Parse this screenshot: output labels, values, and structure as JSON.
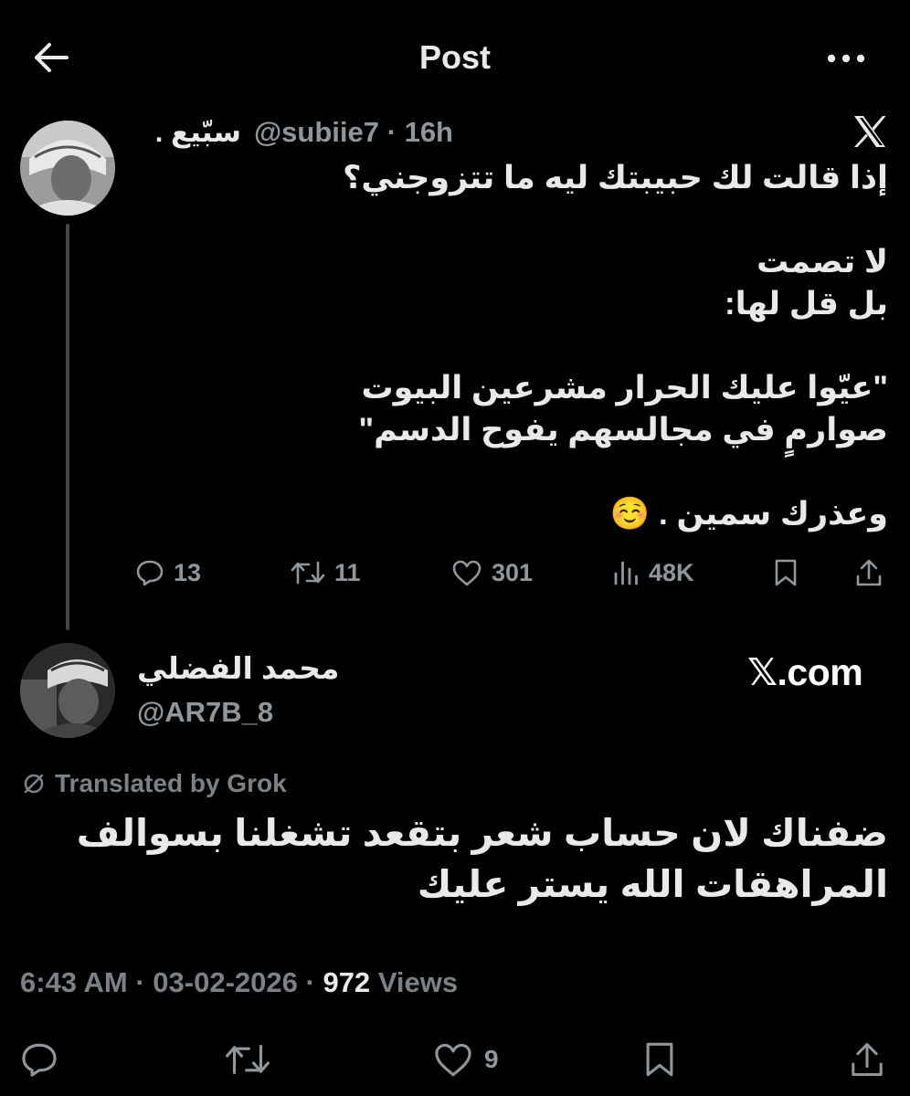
{
  "header": {
    "title": "Post"
  },
  "quoted_post": {
    "author_name": "سبّيع .",
    "handle": "@subiie7",
    "separator": "·",
    "time": "16h",
    "lines": [
      "إذا قالت لك حبيبتك ليه ما تتزوجني؟",
      "",
      "لا تصمت",
      "بل قل لها:",
      "",
      "\"عيّوا عليك الحرار مشرعين البيوت",
      "صوارمٍ في مجالسهم يفوح الدسم\"",
      "",
      "وعذرك سمين . ☺️"
    ],
    "stats": {
      "replies": "13",
      "reposts": "11",
      "likes": "301",
      "views": "48K"
    }
  },
  "main_post": {
    "author_name": "محمد الفضلي",
    "handle": "@AR7B_8",
    "source_label": "𝕏.com",
    "translated_label": "Translated by Grok",
    "text_lines": [
      "ضفناك لان حساب شعر بتقعد تشغلنا بسوالف",
      "المراهقات الله يستر عليك"
    ],
    "time": "6:43 AM",
    "separator": "·",
    "date": "03-02-2026",
    "views_count": "972",
    "views_label": "Views",
    "likes": "9"
  },
  "colors": {
    "background": "#000000",
    "text": "#e7e9ea",
    "muted": "#8f969c"
  },
  "icons": [
    "back-arrow-icon",
    "more-icon",
    "x-logo-icon",
    "reply-icon",
    "repost-icon",
    "like-icon",
    "views-icon",
    "bookmark-icon",
    "share-icon",
    "translate-icon"
  ]
}
